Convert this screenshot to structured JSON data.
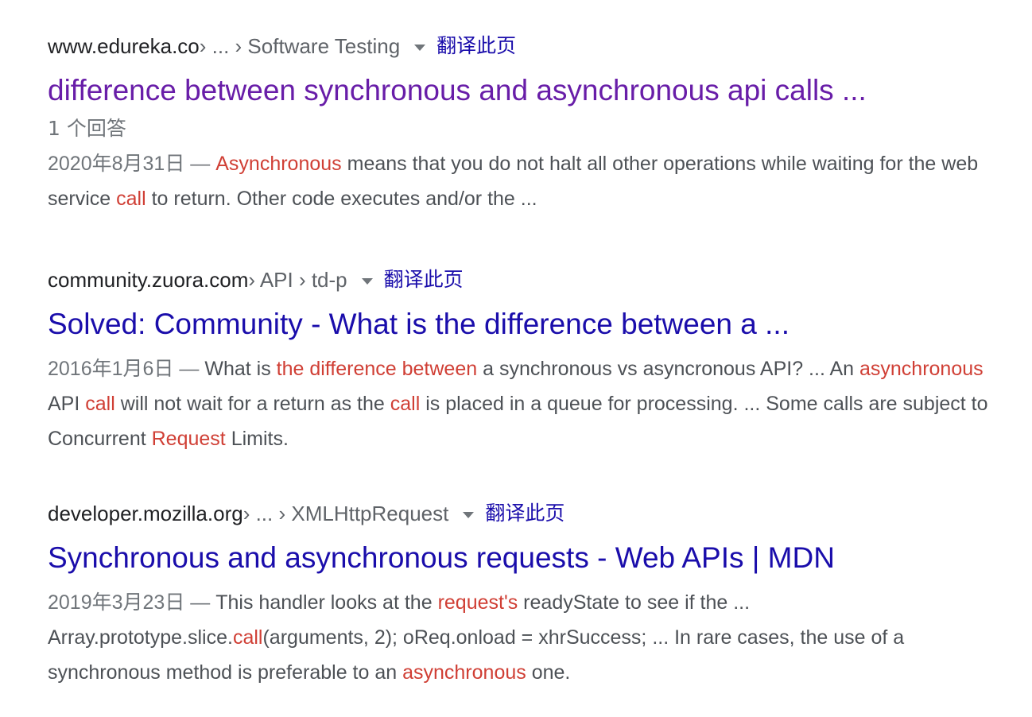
{
  "results": [
    {
      "domain": "www.edureka.co",
      "breadcrumb": " › ... › Software Testing",
      "translate_label": "翻译此页",
      "title": "difference between synchronous and asynchronous api calls ...",
      "answers": "1 个回答",
      "date": "2020年8月31日",
      "sep": " — ",
      "snippet_parts": [
        "Asynchronous",
        " means that you do not halt all other operations while waiting for the web service ",
        "call",
        " to return. Other code executes and/or the ..."
      ]
    },
    {
      "domain": "community.zuora.com",
      "breadcrumb": " › API › td-p",
      "translate_label": "翻译此页",
      "title": "Solved: Community - What is the difference between a ...",
      "date": "2016年1月6日",
      "sep": " — ",
      "snippet_parts": [
        "What is ",
        "the difference between",
        " a synchronous vs asyncronous API? ... An ",
        "asynchronous",
        " API ",
        "call",
        " will not wait for a return as the ",
        "call",
        " is placed in a queue for processing. ... Some calls are subject to Concurrent ",
        "Request",
        " Limits."
      ]
    },
    {
      "domain": "developer.mozilla.org",
      "breadcrumb": " › ... › XMLHttpRequest",
      "translate_label": "翻译此页",
      "title": "Synchronous and asynchronous requests - Web APIs | MDN",
      "date": "2019年3月23日",
      "sep": " — ",
      "snippet_parts": [
        "This handler looks at the ",
        "request's",
        " readyState to see if the ... Array.prototype.slice.",
        "call",
        "(arguments, 2); oReq.onload = xhrSuccess; ... In rare cases, the use of a synchronous method is preferable to an ",
        "asynchronous",
        " one."
      ]
    }
  ],
  "colors": {
    "link_unvisited": "#1a0dab",
    "link_visited": "#681da8",
    "highlight": "#d03f35",
    "snippet_text": "#4d5156",
    "meta_text": "#70757a"
  }
}
